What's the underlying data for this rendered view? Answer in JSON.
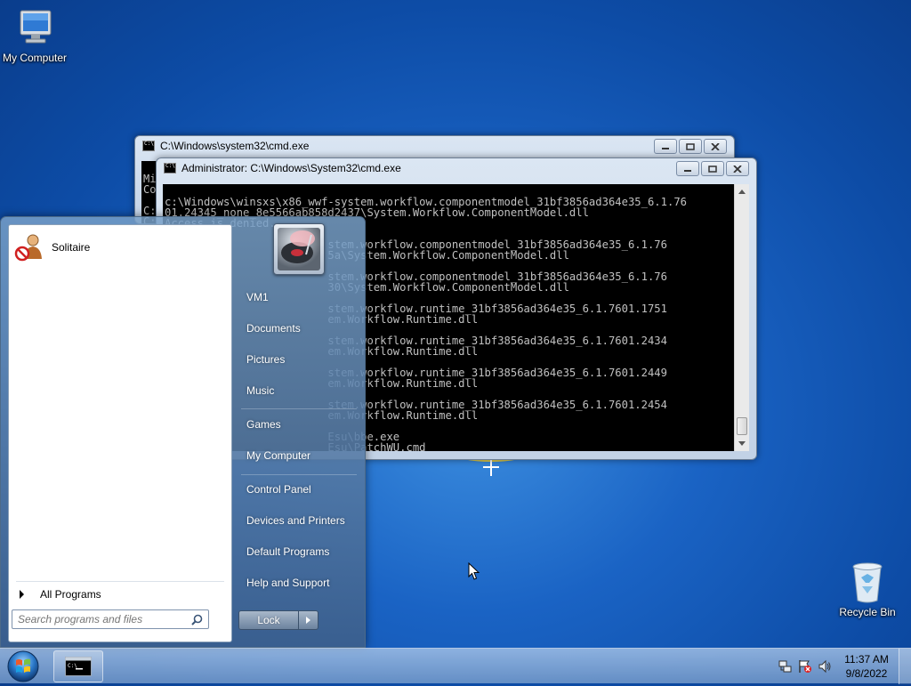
{
  "desktop": {
    "icons": [
      {
        "label": "My Computer",
        "icon": "computer-icon"
      },
      {
        "label": "Recycle Bin",
        "icon": "recycle-bin-icon"
      }
    ]
  },
  "windows": [
    {
      "title": "C:\\Windows\\system32\\cmd.exe",
      "partial_lines": [
        "Mi",
        "Co",
        "",
        "C:",
        "C:",
        "C:"
      ]
    },
    {
      "title": "Administrator: C:\\Windows\\System32\\cmd.exe",
      "console_lines": [
        "c:\\Windows\\winsxs\\x86_wwf-system.workflow.componentmodel_31bf3856ad364e35_6.1.76",
        "01.24345_none_8e5566ab858d2437\\System.Workflow.ComponentModel.dll",
        "Access is denied.",
        "",
        "                         stem.workflow.componentmodel_31bf3856ad364e35_6.1.76",
        "                         5a\\System.Workflow.ComponentModel.dll",
        "",
        "                         stem.workflow.componentmodel_31bf3856ad364e35_6.1.76",
        "                         30\\System.Workflow.ComponentModel.dll",
        "",
        "                         stem.workflow.runtime_31bf3856ad364e35_6.1.7601.1751",
        "                         em.Workflow.Runtime.dll",
        "",
        "                         stem.workflow.runtime_31bf3856ad364e35_6.1.7601.2434",
        "                         em.Workflow.Runtime.dll",
        "",
        "                         stem.workflow.runtime_31bf3856ad364e35_6.1.7601.2449",
        "                         em.Workflow.Runtime.dll",
        "",
        "                         stem.workflow.runtime_31bf3856ad364e35_6.1.7601.2454",
        "                         em.Workflow.Runtime.dll",
        "",
        "                         Esu\\bbe.exe",
        "                         Esu\\PatchWU.cmd"
      ]
    }
  ],
  "start_menu": {
    "pinned_programs": [
      {
        "label": "Solitaire",
        "icon": "solitaire-icon"
      }
    ],
    "all_programs_label": "All Programs",
    "search_placeholder": "Search programs and files",
    "right_items": [
      {
        "label": "VM1"
      },
      {
        "label": "Documents"
      },
      {
        "label": "Pictures"
      },
      {
        "label": "Music"
      },
      {
        "label": "Games"
      },
      {
        "label": "My Computer"
      },
      {
        "label": "Control Panel"
      },
      {
        "label": "Devices and Printers"
      },
      {
        "label": "Default Programs"
      },
      {
        "label": "Help and Support"
      }
    ],
    "lock_label": "Lock"
  },
  "taskbar": {
    "tasks": [
      {
        "name": "cmd",
        "icon": "cmd-icon"
      }
    ],
    "tray_icons": [
      "network-icon",
      "action-center-icon",
      "volume-icon"
    ],
    "time": "11:37 AM",
    "date": "9/8/2022"
  },
  "colors": {
    "wallpaper": "#1a63c4",
    "console_bg": "#000000",
    "console_fg": "#c0c0c0"
  }
}
